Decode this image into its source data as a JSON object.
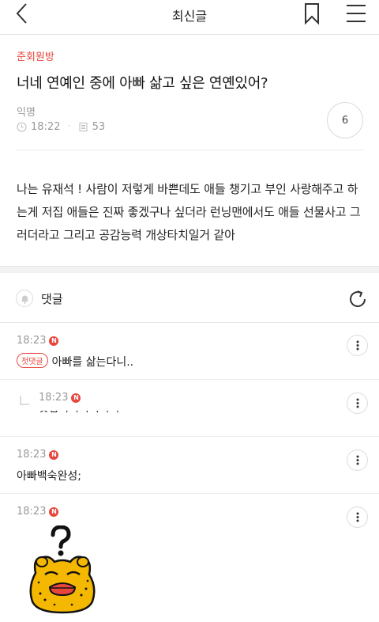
{
  "header": {
    "title": "최신글"
  },
  "post": {
    "board": "준회원방",
    "title": "너네 연예인 중에 아빠 삶고 싶은 연옌있어?",
    "author": "익명",
    "time": "18:22",
    "views": "53",
    "likes": "6",
    "body": "나는 유재석 ! 사람이 저렇게 바쁜데도 애들 챙기고 부인 사랑해주고 하는게 저집 애들은 진짜 좋겠구나 싶더라 런닝맨에서도 애들 선물사고 그러더라고 그리고 공감능력 개상타치일거 같아"
  },
  "comments_section": {
    "label": "댓글"
  },
  "comments": [
    {
      "time": "18:23",
      "new_badge": "N",
      "first_badge": "첫댓글",
      "text": "아빠를 삶는다니.."
    },
    {
      "time": "18:23",
      "new_badge": "N",
      "text": "ㅅㅂㅋㅋㅋㅋㅋㅋ"
    },
    {
      "time": "18:23",
      "new_badge": "N",
      "text": "아빠백숙완성;"
    },
    {
      "time": "18:23",
      "new_badge": "N"
    }
  ],
  "colors": {
    "accent": "#e8453c",
    "muted": "#999999",
    "divider": "#ececec"
  }
}
